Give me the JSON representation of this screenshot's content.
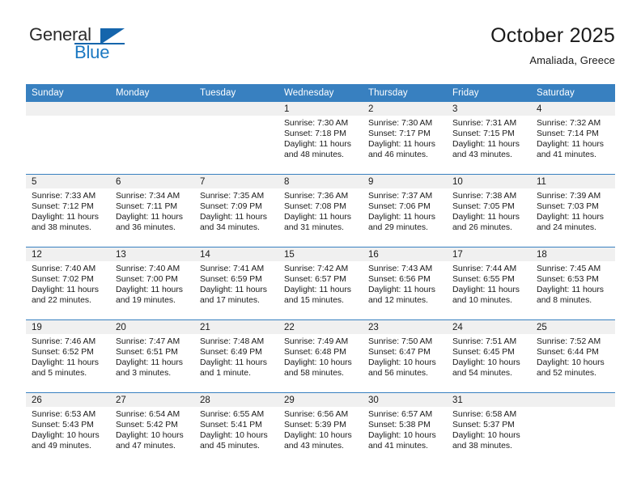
{
  "logo": {
    "word1": "General",
    "word2": "Blue",
    "triangle_color": "#1565ac",
    "blue_text_color": "#1b78c2"
  },
  "header": {
    "title": "October 2025",
    "subtitle": "Amaliada, Greece"
  },
  "theme": {
    "header_bar_color": "#3880c0",
    "daynum_bar_color": "#f0f0f0",
    "text_color": "#1a1a1a"
  },
  "weekday_headers": [
    "Sunday",
    "Monday",
    "Tuesday",
    "Wednesday",
    "Thursday",
    "Friday",
    "Saturday"
  ],
  "weeks": [
    [
      {
        "day": "",
        "sunrise": "",
        "sunset": "",
        "daylight": ""
      },
      {
        "day": "",
        "sunrise": "",
        "sunset": "",
        "daylight": ""
      },
      {
        "day": "",
        "sunrise": "",
        "sunset": "",
        "daylight": ""
      },
      {
        "day": "1",
        "sunrise": "Sunrise: 7:30 AM",
        "sunset": "Sunset: 7:18 PM",
        "daylight": "Daylight: 11 hours and 48 minutes."
      },
      {
        "day": "2",
        "sunrise": "Sunrise: 7:30 AM",
        "sunset": "Sunset: 7:17 PM",
        "daylight": "Daylight: 11 hours and 46 minutes."
      },
      {
        "day": "3",
        "sunrise": "Sunrise: 7:31 AM",
        "sunset": "Sunset: 7:15 PM",
        "daylight": "Daylight: 11 hours and 43 minutes."
      },
      {
        "day": "4",
        "sunrise": "Sunrise: 7:32 AM",
        "sunset": "Sunset: 7:14 PM",
        "daylight": "Daylight: 11 hours and 41 minutes."
      }
    ],
    [
      {
        "day": "5",
        "sunrise": "Sunrise: 7:33 AM",
        "sunset": "Sunset: 7:12 PM",
        "daylight": "Daylight: 11 hours and 38 minutes."
      },
      {
        "day": "6",
        "sunrise": "Sunrise: 7:34 AM",
        "sunset": "Sunset: 7:11 PM",
        "daylight": "Daylight: 11 hours and 36 minutes."
      },
      {
        "day": "7",
        "sunrise": "Sunrise: 7:35 AM",
        "sunset": "Sunset: 7:09 PM",
        "daylight": "Daylight: 11 hours and 34 minutes."
      },
      {
        "day": "8",
        "sunrise": "Sunrise: 7:36 AM",
        "sunset": "Sunset: 7:08 PM",
        "daylight": "Daylight: 11 hours and 31 minutes."
      },
      {
        "day": "9",
        "sunrise": "Sunrise: 7:37 AM",
        "sunset": "Sunset: 7:06 PM",
        "daylight": "Daylight: 11 hours and 29 minutes."
      },
      {
        "day": "10",
        "sunrise": "Sunrise: 7:38 AM",
        "sunset": "Sunset: 7:05 PM",
        "daylight": "Daylight: 11 hours and 26 minutes."
      },
      {
        "day": "11",
        "sunrise": "Sunrise: 7:39 AM",
        "sunset": "Sunset: 7:03 PM",
        "daylight": "Daylight: 11 hours and 24 minutes."
      }
    ],
    [
      {
        "day": "12",
        "sunrise": "Sunrise: 7:40 AM",
        "sunset": "Sunset: 7:02 PM",
        "daylight": "Daylight: 11 hours and 22 minutes."
      },
      {
        "day": "13",
        "sunrise": "Sunrise: 7:40 AM",
        "sunset": "Sunset: 7:00 PM",
        "daylight": "Daylight: 11 hours and 19 minutes."
      },
      {
        "day": "14",
        "sunrise": "Sunrise: 7:41 AM",
        "sunset": "Sunset: 6:59 PM",
        "daylight": "Daylight: 11 hours and 17 minutes."
      },
      {
        "day": "15",
        "sunrise": "Sunrise: 7:42 AM",
        "sunset": "Sunset: 6:57 PM",
        "daylight": "Daylight: 11 hours and 15 minutes."
      },
      {
        "day": "16",
        "sunrise": "Sunrise: 7:43 AM",
        "sunset": "Sunset: 6:56 PM",
        "daylight": "Daylight: 11 hours and 12 minutes."
      },
      {
        "day": "17",
        "sunrise": "Sunrise: 7:44 AM",
        "sunset": "Sunset: 6:55 PM",
        "daylight": "Daylight: 11 hours and 10 minutes."
      },
      {
        "day": "18",
        "sunrise": "Sunrise: 7:45 AM",
        "sunset": "Sunset: 6:53 PM",
        "daylight": "Daylight: 11 hours and 8 minutes."
      }
    ],
    [
      {
        "day": "19",
        "sunrise": "Sunrise: 7:46 AM",
        "sunset": "Sunset: 6:52 PM",
        "daylight": "Daylight: 11 hours and 5 minutes."
      },
      {
        "day": "20",
        "sunrise": "Sunrise: 7:47 AM",
        "sunset": "Sunset: 6:51 PM",
        "daylight": "Daylight: 11 hours and 3 minutes."
      },
      {
        "day": "21",
        "sunrise": "Sunrise: 7:48 AM",
        "sunset": "Sunset: 6:49 PM",
        "daylight": "Daylight: 11 hours and 1 minute."
      },
      {
        "day": "22",
        "sunrise": "Sunrise: 7:49 AM",
        "sunset": "Sunset: 6:48 PM",
        "daylight": "Daylight: 10 hours and 58 minutes."
      },
      {
        "day": "23",
        "sunrise": "Sunrise: 7:50 AM",
        "sunset": "Sunset: 6:47 PM",
        "daylight": "Daylight: 10 hours and 56 minutes."
      },
      {
        "day": "24",
        "sunrise": "Sunrise: 7:51 AM",
        "sunset": "Sunset: 6:45 PM",
        "daylight": "Daylight: 10 hours and 54 minutes."
      },
      {
        "day": "25",
        "sunrise": "Sunrise: 7:52 AM",
        "sunset": "Sunset: 6:44 PM",
        "daylight": "Daylight: 10 hours and 52 minutes."
      }
    ],
    [
      {
        "day": "26",
        "sunrise": "Sunrise: 6:53 AM",
        "sunset": "Sunset: 5:43 PM",
        "daylight": "Daylight: 10 hours and 49 minutes."
      },
      {
        "day": "27",
        "sunrise": "Sunrise: 6:54 AM",
        "sunset": "Sunset: 5:42 PM",
        "daylight": "Daylight: 10 hours and 47 minutes."
      },
      {
        "day": "28",
        "sunrise": "Sunrise: 6:55 AM",
        "sunset": "Sunset: 5:41 PM",
        "daylight": "Daylight: 10 hours and 45 minutes."
      },
      {
        "day": "29",
        "sunrise": "Sunrise: 6:56 AM",
        "sunset": "Sunset: 5:39 PM",
        "daylight": "Daylight: 10 hours and 43 minutes."
      },
      {
        "day": "30",
        "sunrise": "Sunrise: 6:57 AM",
        "sunset": "Sunset: 5:38 PM",
        "daylight": "Daylight: 10 hours and 41 minutes."
      },
      {
        "day": "31",
        "sunrise": "Sunrise: 6:58 AM",
        "sunset": "Sunset: 5:37 PM",
        "daylight": "Daylight: 10 hours and 38 minutes."
      },
      {
        "day": "",
        "sunrise": "",
        "sunset": "",
        "daylight": ""
      }
    ]
  ]
}
